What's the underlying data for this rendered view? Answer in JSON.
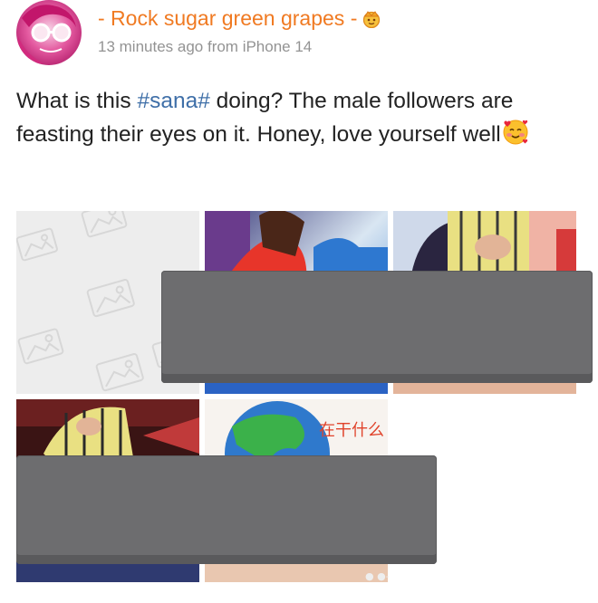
{
  "post": {
    "author": {
      "name": "- Rock sugar green grapes -",
      "badge_icon": "crown-icon",
      "avatar_icon": "avatar-glasses-icon"
    },
    "meta": "13 minutes ago from iPhone 14",
    "text": {
      "part1": "What is this ",
      "hashtag": "#sana#",
      "part2": " doing? The male followers are feasting their eyes on it. Honey, love yourself well",
      "emoji_icon": "smiling-face-with-hearts-icon"
    },
    "images": {
      "count_visible": 5,
      "overlay_text": "在干什么",
      "watermark": "● ●-"
    }
  },
  "colors": {
    "username": "#f07a22",
    "hashtag": "#3f6fa8",
    "meta": "#939393",
    "redaction": "#6d6d6f",
    "placeholder": "#ededed"
  }
}
